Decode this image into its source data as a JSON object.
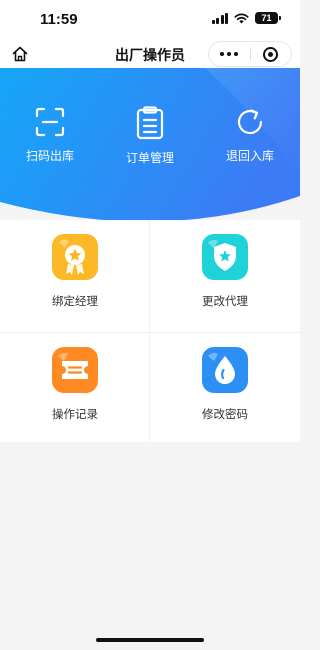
{
  "status_bar": {
    "time": "11:59",
    "battery": "71"
  },
  "nav": {
    "title": "出厂操作员"
  },
  "hero_actions": [
    {
      "label": "扫码出库",
      "icon": "scan-icon"
    },
    {
      "label": "订单管理",
      "icon": "clipboard-icon"
    },
    {
      "label": "退回入库",
      "icon": "refresh-icon"
    }
  ],
  "grid": [
    {
      "label": "绑定经理",
      "icon": "medal-icon",
      "color": "#fdb827"
    },
    {
      "label": "更改代理",
      "icon": "shield-star-icon",
      "color": "#1ed2d8"
    },
    {
      "label": "操作记录",
      "icon": "ticket-icon",
      "color": "#fd8a22"
    },
    {
      "label": "修改密码",
      "icon": "water-drop-icon",
      "color": "#2b8ff4"
    }
  ],
  "colors": {
    "hero_start": "#15a6f7",
    "hero_end": "#3c7bf6"
  }
}
